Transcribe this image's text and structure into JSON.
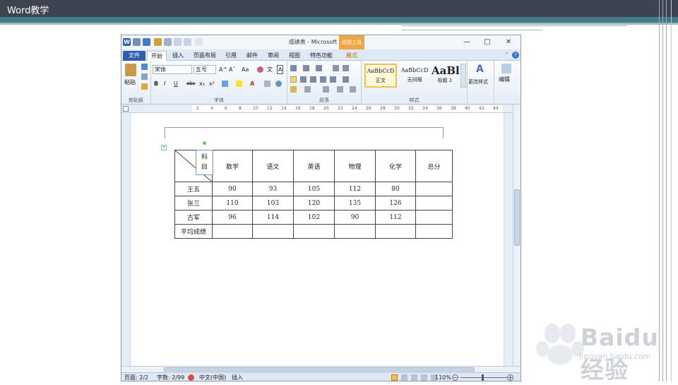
{
  "slide": {
    "title": "Word教学"
  },
  "window": {
    "title": "成绩表 - Microsoft Word",
    "context_tab_group": "绘图工具",
    "minimize": "—",
    "maximize": "□",
    "close": "✕"
  },
  "tabs": [
    {
      "label": "文件"
    },
    {
      "label": "开始"
    },
    {
      "label": "插入"
    },
    {
      "label": "页面布局"
    },
    {
      "label": "引用"
    },
    {
      "label": "邮件"
    },
    {
      "label": "审阅"
    },
    {
      "label": "视图"
    },
    {
      "label": "特色功能"
    },
    {
      "label": "格式"
    }
  ],
  "ribbon": {
    "clipboard": {
      "paste": "粘贴",
      "label": "剪贴板"
    },
    "font": {
      "name": "宋体",
      "size": "五号",
      "label": "字体",
      "bold": "B",
      "italic": "I",
      "underline": "U",
      "strike": "abc",
      "sub": "x₂",
      "sup": "x²",
      "grow": "A^",
      "shrink": "Aˇ",
      "case": "Aa",
      "fontcolor": "A",
      "charborder": "A",
      "wen": "文"
    },
    "paragraph": {
      "label": "段落"
    },
    "styles": {
      "label": "样式",
      "items": [
        {
          "preview": "AaBbCcD",
          "name": "正文"
        },
        {
          "preview": "AaBbCcD",
          "name": "无间隔"
        },
        {
          "preview": "AaBl",
          "name": "标题 1"
        }
      ],
      "change": "更改样式"
    },
    "editing": {
      "label": "编辑"
    }
  },
  "ruler": {
    "ticks": [
      "2",
      "4",
      "6",
      "8",
      "10",
      "12",
      "14",
      "16",
      "18",
      "20",
      "22",
      "24",
      "26",
      "28",
      "30",
      "32",
      "34",
      "36",
      "38",
      "40",
      "42",
      "44"
    ]
  },
  "table": {
    "corner": [
      "科",
      "目"
    ],
    "headers": [
      "数学",
      "语文",
      "英语",
      "物理",
      "化学",
      "总分"
    ],
    "rows": [
      {
        "name": "王五",
        "cells": [
          "90",
          "93",
          "105",
          "112",
          "80",
          ""
        ]
      },
      {
        "name": "张三",
        "cells": [
          "110",
          "103",
          "120",
          "135",
          "126",
          ""
        ]
      },
      {
        "name": "古军",
        "cells": [
          "96",
          "114",
          "102",
          "90",
          "112",
          ""
        ]
      },
      {
        "name": "平均成绩",
        "cells": [
          "",
          "",
          "",
          "",
          "",
          ""
        ]
      }
    ]
  },
  "status": {
    "page": "页面: 2/2",
    "words": "字数: 2/99",
    "language": "中文(中国)",
    "insert": "插入",
    "zoom": "110%"
  },
  "watermark": {
    "brand": "Baidu 经验",
    "url": "jingyan.baidu.com"
  },
  "colors": {
    "header_bar": "#3e4352",
    "teal": "#447a86",
    "file_tab": "#2f5ea8",
    "context": "#f2a544"
  }
}
